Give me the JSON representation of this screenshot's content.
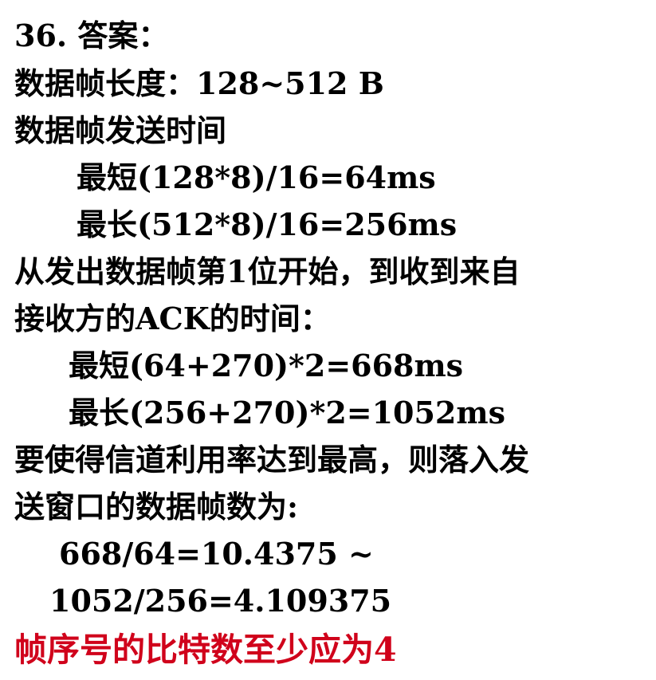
{
  "lines": [
    "36. 答案：",
    "数据帧长度：128~512 B",
    "数据帧发送时间",
    "最短(128*8)/16=64ms",
    "最长(512*8)/16=256ms",
    "从发出数据帧第1位开始，到收到来自",
    "接收方的ACK的时间：",
    "最短(64+270)*2=668ms",
    "最长(256+270)*2=1052ms",
    "要使得信道利用率达到最高，则落入发",
    "送窗口的数据帧数为:",
    "668/64=10.4375 ~",
    "1052/256=4.109375",
    "帧序号的比特数至少应为4"
  ],
  "colors": {
    "text": "#000000",
    "highlight": "#d0021b"
  }
}
